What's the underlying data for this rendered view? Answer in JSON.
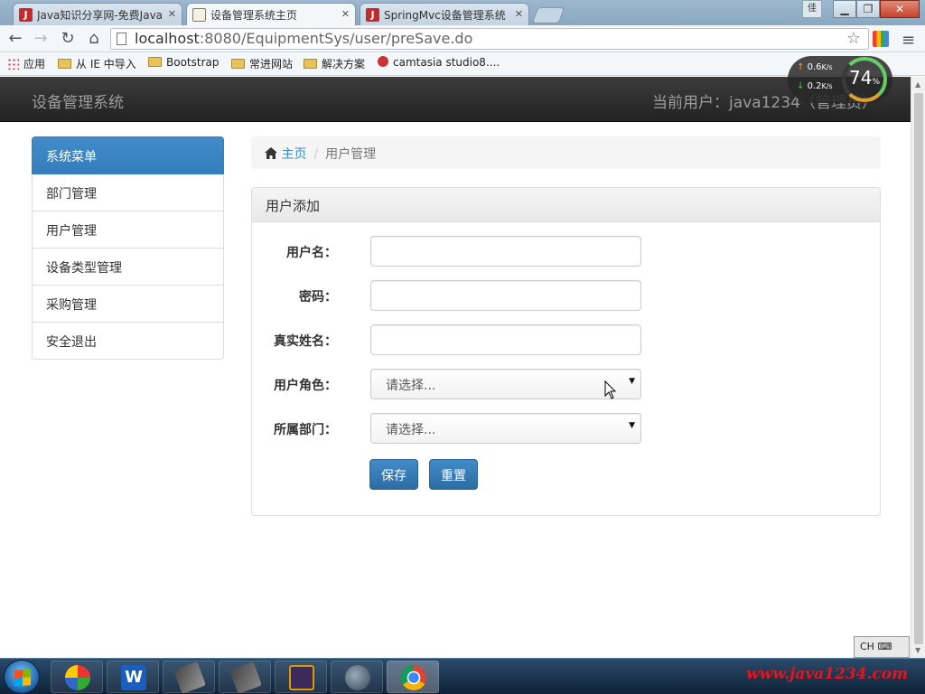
{
  "browser": {
    "tabs": [
      {
        "title": "Java知识分享网-免费Java",
        "icon": "java1234-favicon"
      },
      {
        "title": "设备管理系统主页",
        "icon": "document-favicon"
      },
      {
        "title": "SpringMvc设备管理系统",
        "icon": "java1234-favicon"
      }
    ],
    "url_host": "localhost",
    "url_rest": ":8080/EquipmentSys/user/preSave.do",
    "bookmarks": [
      {
        "label": "应用",
        "icon": "apps-icon"
      },
      {
        "label": "从 IE 中导入",
        "icon": "folder-icon"
      },
      {
        "label": "Bootstrap",
        "icon": "folder-icon"
      },
      {
        "label": "常进网站",
        "icon": "folder-icon"
      },
      {
        "label": "解决方案",
        "icon": "folder-icon"
      },
      {
        "label": "camtasia studio8....",
        "icon": "camtasia-icon"
      }
    ],
    "window_user_label": "佳"
  },
  "speed_widget": {
    "upload": "0.6",
    "download": "0.2",
    "unit": "K/s",
    "percent": "74",
    "percent_sign": "%"
  },
  "navbar": {
    "brand": "设备管理系统",
    "current_user": "当前用户：java1234（管理员）"
  },
  "sidebar": {
    "title": "系统菜单",
    "items": [
      {
        "label": "部门管理"
      },
      {
        "label": "用户管理"
      },
      {
        "label": "设备类型管理"
      },
      {
        "label": "采购管理"
      },
      {
        "label": "安全退出"
      }
    ]
  },
  "breadcrumb": {
    "home": "主页",
    "current": "用户管理"
  },
  "form": {
    "title": "用户添加",
    "username_label": "用户名：",
    "username_value": "",
    "password_label": "密码：",
    "password_value": "",
    "realname_label": "真实姓名：",
    "realname_value": "",
    "role_label": "用户角色：",
    "role_selected": "请选择...",
    "dept_label": "所属部门：",
    "dept_selected": "请选择...",
    "save_label": "保存",
    "reset_label": "重置"
  },
  "taskbar": {
    "lang": "CH",
    "apps": [
      "windows-start",
      "picasa",
      "wps-writer",
      "unknown-app",
      "unknown-app-2",
      "javaee-ide",
      "dolphin",
      "chrome"
    ]
  },
  "watermark": "www.java1234.com",
  "colors": {
    "primary": "#428bca",
    "navbar": "#222222",
    "watermark": "#e8141c"
  }
}
